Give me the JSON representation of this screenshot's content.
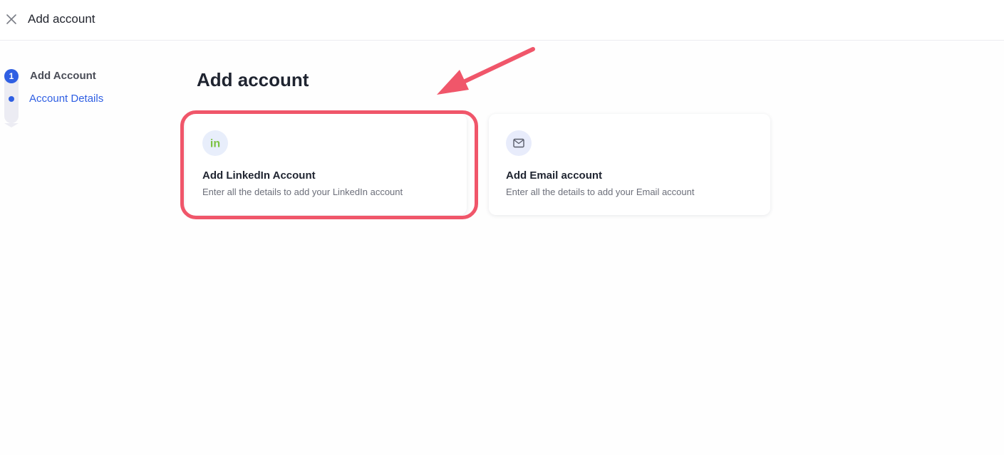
{
  "header": {
    "title": "Add account",
    "close_icon": "close-icon"
  },
  "stepper": {
    "steps": [
      {
        "number": "1",
        "label": "Add Account",
        "state": "completed"
      },
      {
        "label": "Account Details",
        "state": "active"
      }
    ],
    "active_color": "#2f5fe3"
  },
  "main": {
    "heading": "Add account",
    "cards": [
      {
        "icon": "linkedin-icon",
        "icon_text": "in",
        "title": "Add LinkedIn Account",
        "description": "Enter all the details to add your LinkedIn account",
        "highlighted": true
      },
      {
        "icon": "mail-icon",
        "title": "Add Email account",
        "description": "Enter all the details to add your Email account",
        "highlighted": false
      }
    ]
  },
  "annotation": {
    "color": "#f0566a",
    "arrow_icon": "arrow-icon"
  },
  "colors": {
    "accent": "#2f5fe3",
    "linkedin_green": "#7cc242",
    "annotation_red": "#f0566a"
  }
}
